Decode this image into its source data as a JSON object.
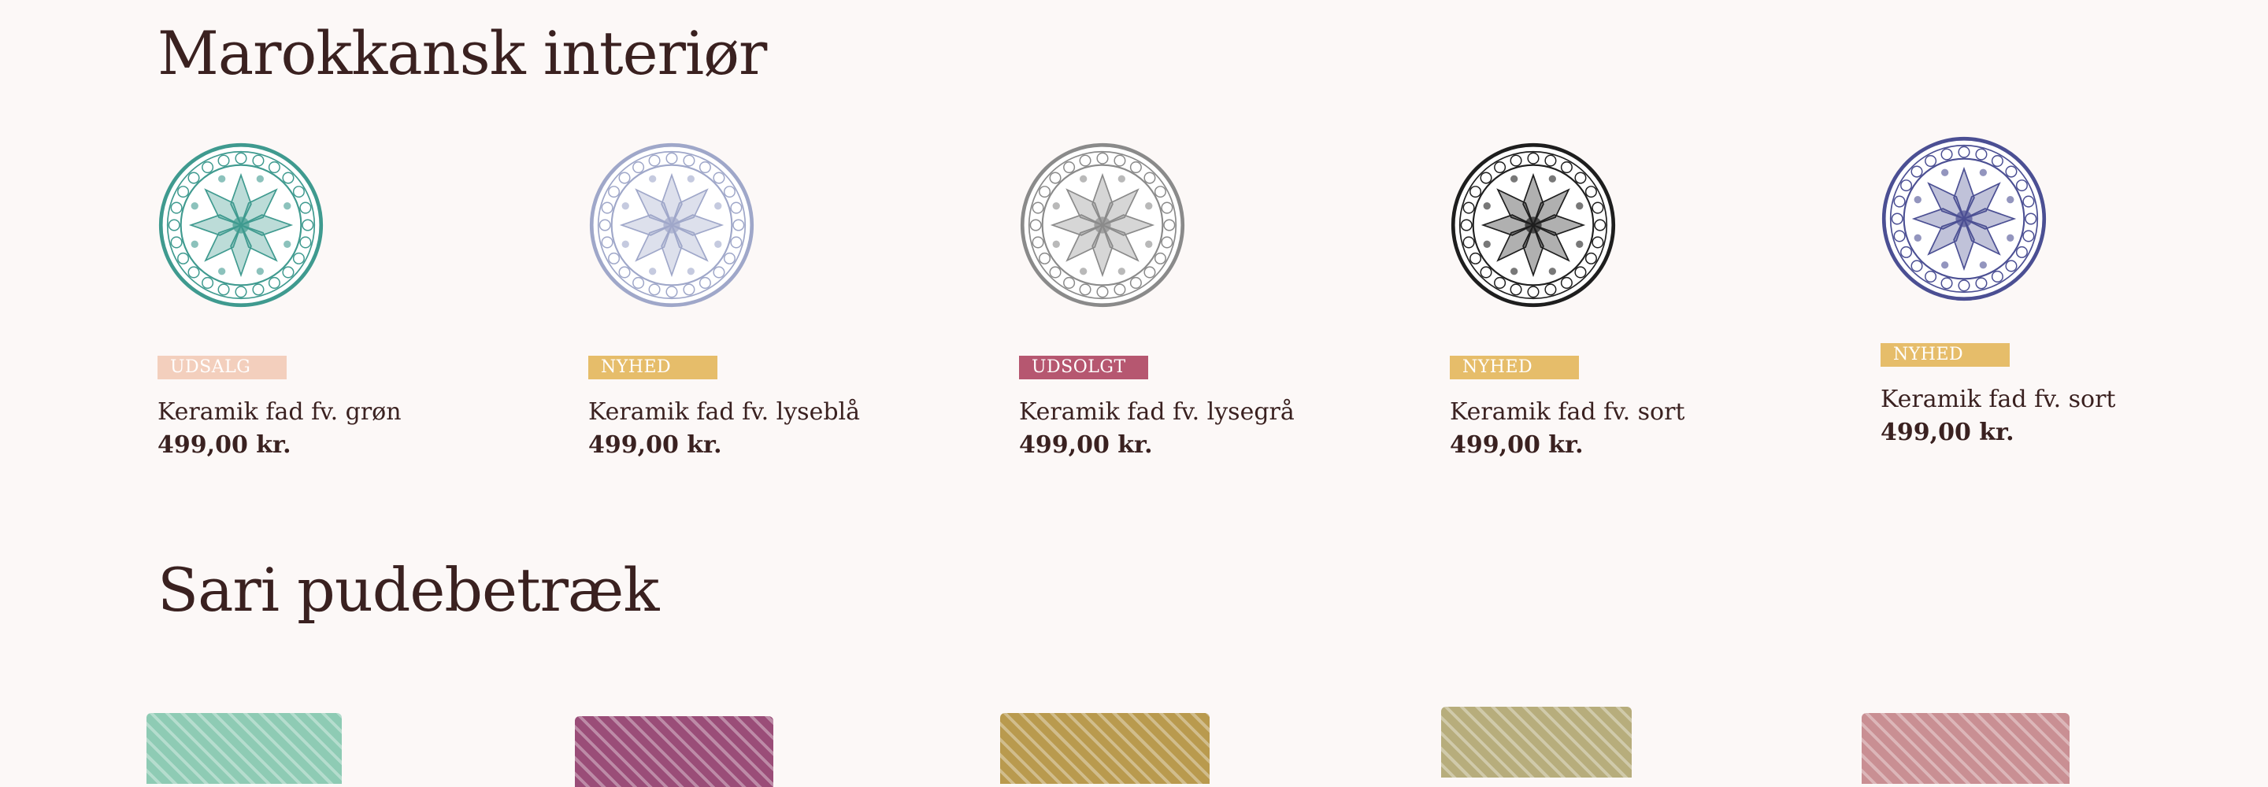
{
  "sections": [
    {
      "title": "Marokkansk interiør",
      "products": [
        {
          "badge": "UDSALG",
          "badge_type": "sale",
          "name": "Keramik fad fv. grøn",
          "price": "499,00 kr.",
          "plate_color": "#3f9a8f",
          "image": "green-plate"
        },
        {
          "badge": "NYHED",
          "badge_type": "new",
          "name": "Keramik fad fv. lyseblå",
          "price": "499,00 kr.",
          "plate_color": "#9fa7c9",
          "image": "light-blue-plate"
        },
        {
          "badge": "UDSOLGT",
          "badge_type": "soldout",
          "name": "Keramik fad fv. lysegrå",
          "price": "499,00 kr.",
          "plate_color": "#8a8a8a",
          "image": "light-grey-plate"
        },
        {
          "badge": "NYHED",
          "badge_type": "new",
          "name": "Keramik fad fv. sort",
          "price": "499,00 kr.",
          "plate_color": "#1e1e1e",
          "image": "black-plate"
        },
        {
          "badge": "NYHED",
          "badge_type": "new",
          "name": "Keramik fad fv. sort",
          "price": "499,00 kr.",
          "plate_color": "#4b4f93",
          "image": "blue-plate"
        }
      ]
    },
    {
      "title": "Sari pudebetræk",
      "products": [
        {
          "image": "mint-floral-cushion",
          "color": "#8ecbb4"
        },
        {
          "image": "purple-cushion",
          "color": "#9a4d78"
        },
        {
          "image": "yellow-patchwork-cushion",
          "color": "#b99a4e"
        },
        {
          "image": "olive-cushion",
          "color": "#b7ad7c"
        },
        {
          "image": "pink-green-cushion",
          "color": "#c98f93"
        }
      ]
    }
  ],
  "colors": {
    "background": "#fcf8f7",
    "text": "#3a2120",
    "badge_sale": "#f3cfbd",
    "badge_new": "#e6bd6a",
    "badge_soldout": "#b65770"
  }
}
